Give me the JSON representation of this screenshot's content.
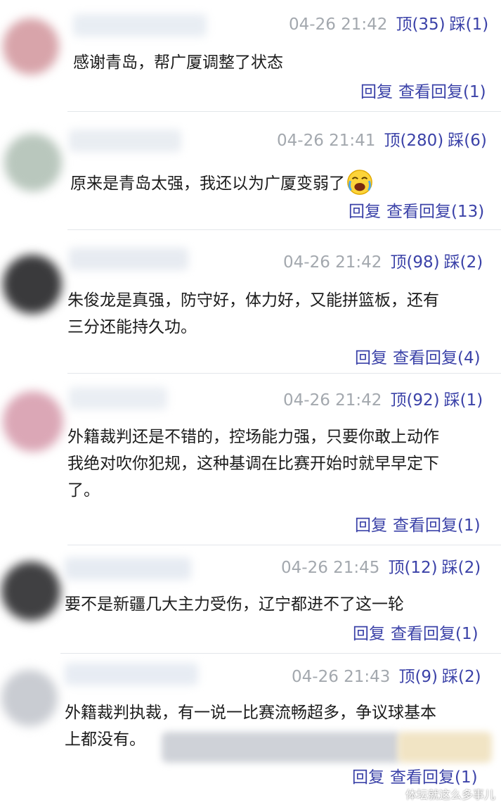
{
  "labels": {
    "reply": "回复"
  },
  "comments": [
    {
      "time": "04-26 21:42",
      "like": "顶(35)",
      "dislike": "踩(1)",
      "lines": [
        "感谢青岛，帮广厦调整了状态"
      ],
      "view_replies": "查看回复(1)"
    },
    {
      "time": "04-26 21:41",
      "like": "顶(280)",
      "dislike": "踩(6)",
      "lines": [
        "原来是青岛太强，我还以为广厦变弱了"
      ],
      "emoji": "crying-laughing-emoji",
      "view_replies": "查看回复(13)"
    },
    {
      "time": "04-26 21:42",
      "like": "顶(98)",
      "dislike": "踩(2)",
      "lines": [
        "朱俊龙是真强，防守好，体力好，又能拼篮板，还有",
        "三分还能持久功。"
      ],
      "view_replies": "查看回复(4)"
    },
    {
      "time": "04-26 21:42",
      "like": "顶(92)",
      "dislike": "踩(1)",
      "lines": [
        "外籍裁判还是不错的，控场能力强，只要你敢上动作",
        "我绝对吹你犯规，这种基调在比赛开始时就早早定下",
        "了。"
      ],
      "view_replies": "查看回复(1)"
    },
    {
      "time": "04-26 21:45",
      "like": "顶(12)",
      "dislike": "踩(2)",
      "lines": [
        "要不是新疆几大主力受伤，辽宁都进不了这一轮"
      ],
      "view_replies": "查看回复(1)"
    },
    {
      "time": "04-26 21:43",
      "like": "顶(9)",
      "dislike": "踩(2)",
      "lines": [
        "外籍裁判执裁，有一说一比赛流畅超多，争议球基本",
        "上都没有。"
      ],
      "view_replies": "查看回复(1)"
    }
  ],
  "watermark": "体坛就这么多事儿",
  "colors": {
    "link": "#3b42a8",
    "meta": "#9aa0a6",
    "text": "#1c1c1c",
    "divider": "#e3e6ea"
  }
}
